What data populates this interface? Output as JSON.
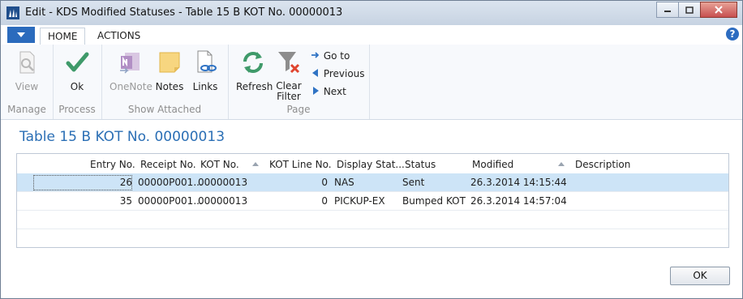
{
  "window": {
    "title": "Edit - KDS Modified Statuses - Table 15 B KOT No. 00000013"
  },
  "tabs": {
    "home": "HOME",
    "actions": "ACTIONS"
  },
  "ribbon": {
    "manage": {
      "label": "Manage",
      "view": "View"
    },
    "process": {
      "label": "Process",
      "ok": "Ok"
    },
    "show_attached": {
      "label": "Show Attached",
      "onenote": "OneNote",
      "notes": "Notes",
      "links": "Links"
    },
    "page": {
      "label": "Page",
      "refresh": "Refresh",
      "clear_filter_line1": "Clear",
      "clear_filter_line2": "Filter",
      "goto": "Go to",
      "previous": "Previous",
      "next": "Next"
    }
  },
  "page_title": "Table 15 B KOT No. 00000013",
  "grid": {
    "headers": [
      "Entry No.",
      "Receipt No.",
      "KOT No.",
      "KOT Line No.",
      "Display Stat...",
      "Status",
      "Modified",
      "Description"
    ],
    "rows": [
      {
        "entry_no": "26",
        "receipt_no": "00000P001...",
        "kot_no": "00000013",
        "kot_line_no": "0",
        "display_station": "NAS",
        "status": "Sent",
        "modified": "26.3.2014 14:15:44",
        "description": ""
      },
      {
        "entry_no": "35",
        "receipt_no": "00000P001...",
        "kot_no": "00000013",
        "kot_line_no": "0",
        "display_station": "PICKUP-EX",
        "status": "Bumped KOT",
        "modified": "26.3.2014 14:57:04",
        "description": ""
      }
    ]
  },
  "footer": {
    "ok": "OK"
  },
  "colors": {
    "accent": "#2b6fb5",
    "selected_row": "#cde4f7"
  }
}
